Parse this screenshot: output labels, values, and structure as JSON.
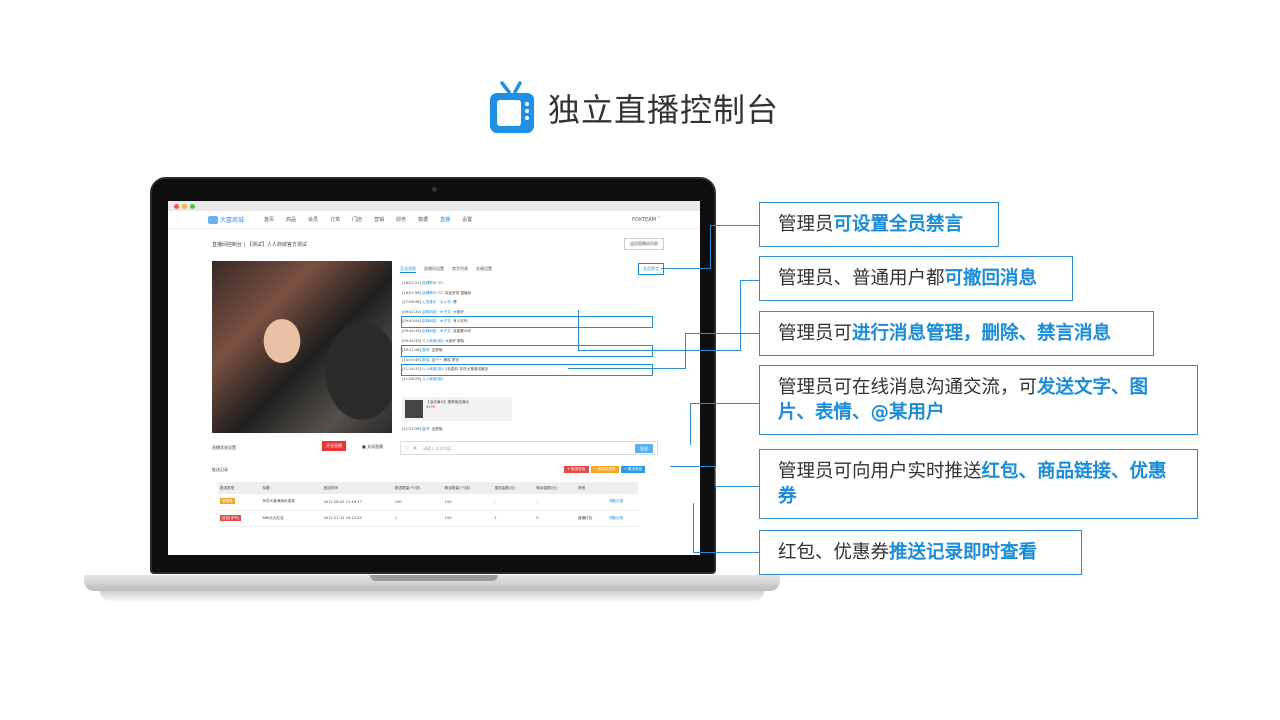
{
  "title": "独立直播控制台",
  "colors": {
    "accent": "#1a8cd8",
    "tv_icon": "#1e90e8"
  },
  "screen": {
    "logo": "大富商城",
    "nav": [
      "首页",
      "商品",
      "会员",
      "订单",
      "门店",
      "营销",
      "财务",
      "数据",
      "直播",
      "设置"
    ],
    "user": "FOXTEAM ˅",
    "breadcrumb": "直播间控制台 | 【测试】人人商城官方测试",
    "back_button": "返回直播间列表",
    "tabs": [
      "互动消息",
      "直播间设置",
      "禁言列表",
      "关键设置"
    ],
    "mute_all_button": "全员禁言",
    "chat": [
      {
        "time": "[16:07:21]",
        "user": "品牌顾问 ZZ:",
        "text": ""
      },
      {
        "time": "[16:07:56]",
        "user": "品牌顾问 ZZ:",
        "text": "欢迎来到 直播间"
      },
      {
        "time": "[17:58:58]",
        "user": "心灵音乐 · 大火学:",
        "text": "嗯"
      },
      {
        "time": "[09:42:20]",
        "user": "启辉科技 · 木子文:",
        "text": "大家好"
      },
      {
        "time": "[09:43:04]",
        "user": "启辉科技 · 木子文:",
        "text": "有人在吗"
      },
      {
        "time": "[09:44:33]",
        "user": "启辉科技 · 木子文:",
        "text": "这能删么吗"
      },
      {
        "time": "[09:44:33]",
        "user": "人人商城(测):",
        "text": "大家好 删除"
      },
      {
        "time": "[10:27:28]",
        "user": "直号:",
        "text": "这是哦"
      },
      {
        "time": "[13:55:49]",
        "user": "群佳:",
        "text": "这个一 删除 禁言"
      },
      {
        "time": "[11:14:17]",
        "user": "人人商城(测):",
        "text": "2兆盈彩 年货大集推送最多"
      },
      {
        "time": "[11:58:29]",
        "user": "人人商城(测):",
        "text": ""
      }
    ],
    "product": {
      "name": "【活动演示】推荐商品演示",
      "price": "¥499"
    },
    "chat_last": {
      "time": "[21:27:28]",
      "user": "直号:",
      "text": "这是哦"
    },
    "input_placeholder": "请输入文本内容...",
    "send_button": "发送",
    "status_label": "直播状态设置",
    "live_button": "开启直播",
    "live_checkbox": "关闭直播",
    "action_buttons": [
      "+ 推送红包",
      "+ 推送优惠券",
      "+ 推送商品"
    ],
    "record_title": "推送记录",
    "record_headers": [
      "推送类型",
      "标题",
      "推送时间",
      "推送数量(个/张)",
      "剩余数量(个/张)",
      "推送金额(元)",
      "剩余金额(元)",
      "其他",
      ""
    ],
    "records": [
      {
        "type": "优惠券",
        "title": "年货大集满减优惠券",
        "time": "2017-08-02 11:16:17",
        "count": "100",
        "remain": "100",
        "amount": "-",
        "remain_amount": "-",
        "other": "",
        "link": "领取记录"
      },
      {
        "type": "红包(手气)",
        "title": "888元大红包",
        "time": "2017-07-31 14:12:22",
        "count": "1",
        "remain": "100",
        "amount": "1",
        "remain_amount": "0",
        "other": "普通红包",
        "link": "领取记录"
      }
    ]
  },
  "callouts": [
    {
      "plain": "管理员",
      "em": "可设置全员禁言"
    },
    {
      "plain": "管理员、普通用户都",
      "em": "可撤回消息"
    },
    {
      "plain": "管理员可",
      "em": "进行消息管理，删除、禁言消息"
    },
    {
      "plain": "管理员可在线消息沟通交流，可",
      "em": "发送文字、图片、表情、@某用户"
    },
    {
      "plain": "管理员可向用户实时推送",
      "em": "红包、商品链接、优惠券"
    },
    {
      "plain": "红包、优惠券",
      "em": "推送记录即时查看"
    }
  ]
}
